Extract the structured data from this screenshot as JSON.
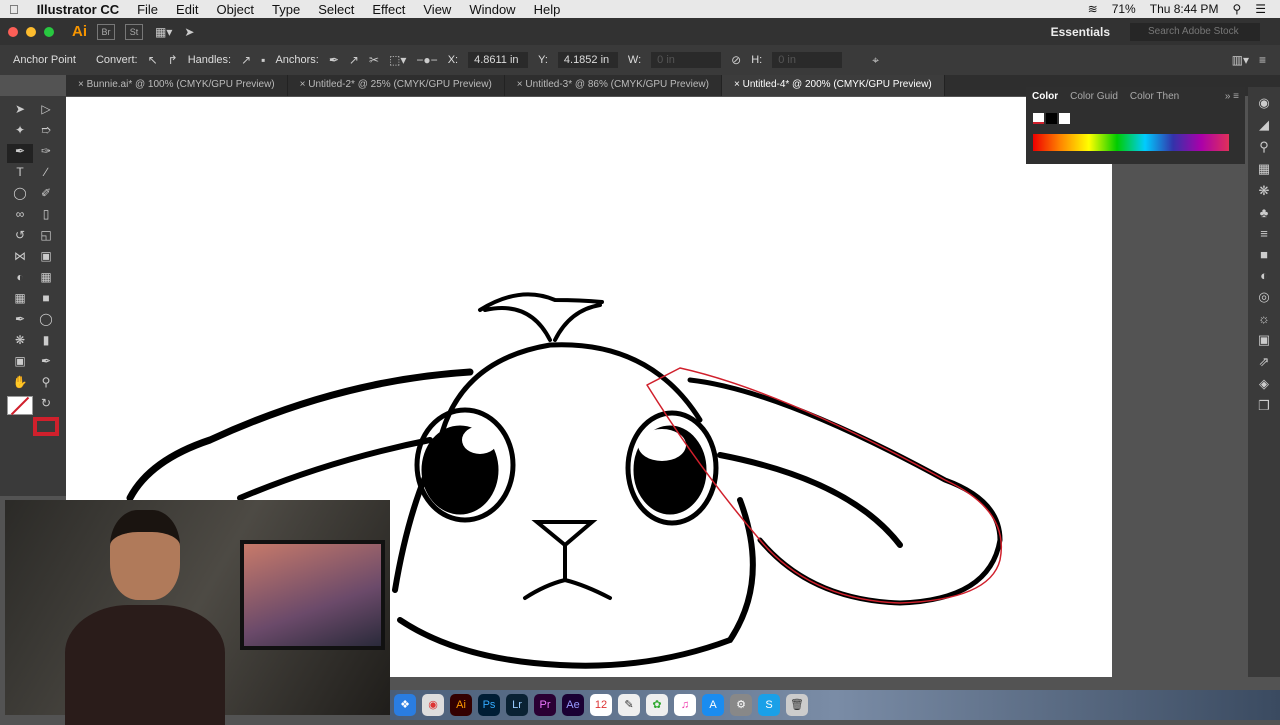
{
  "menubar": {
    "app": "Illustrator CC",
    "items": [
      "File",
      "Edit",
      "Object",
      "Type",
      "Select",
      "Effect",
      "View",
      "Window",
      "Help"
    ],
    "battery": "71%",
    "clock": "Thu 8:44 PM"
  },
  "appbar": {
    "bridge": "Br",
    "stock": "St",
    "workspace": "Essentials",
    "search_placeholder": "Search Adobe Stock"
  },
  "control": {
    "mode": "Anchor Point",
    "convert": "Convert:",
    "handles": "Handles:",
    "anchors": "Anchors:",
    "x_label": "X:",
    "x": "4.8611 in",
    "y_label": "Y:",
    "y": "4.1852 in",
    "w_label": "W:",
    "w": "0 in",
    "h_label": "H:",
    "h": "0 in"
  },
  "tabs": [
    "Bunnie.ai* @ 100% (CMYK/GPU Preview)",
    "Untitled-2* @ 25% (CMYK/GPU Preview)",
    "Untitled-3* @ 86% (CMYK/GPU Preview)",
    "Untitled-4* @ 200% (CMYK/GPU Preview)"
  ],
  "color_panel": {
    "tabs": [
      "Color",
      "Color Guid",
      "Color Then"
    ]
  },
  "colors": {
    "accent": "#f79500",
    "selection": "#d0202c"
  }
}
